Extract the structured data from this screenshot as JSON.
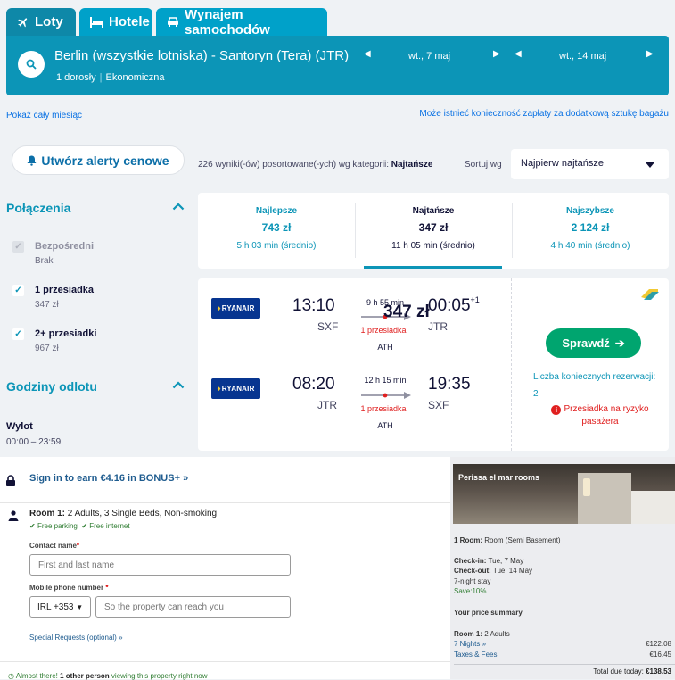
{
  "tabs": [
    {
      "label": "Loty",
      "icon": "plane-icon"
    },
    {
      "label": "Hotele",
      "icon": "bed-icon"
    },
    {
      "label": "Wynajem samochodów",
      "icon": "car-icon"
    }
  ],
  "search": {
    "route": "Berlin (wszystkie lotniska) - Santoryn (Tera) (JTR)",
    "passengers": "1 dorosły",
    "cabin": "Ekonomiczna",
    "depart_date": "wt., 7 maj",
    "return_date": "wt., 14 maj"
  },
  "links": {
    "month": "Pokaż cały miesiąc",
    "baggage": "Może istnieć konieczność zapłaty za dodatkową sztukę bagażu"
  },
  "alerts_button": "Utwórz alerty cenowe",
  "results": {
    "count_text": "226 wyniki(-ów) posortowane(-ych) wg kategorii: ",
    "sort_category": "Najtańsze",
    "sort_label": "Sortuj wg",
    "sort_value": "Najpierw najtańsze"
  },
  "filters": {
    "connections_title": "Połączenia",
    "options": [
      {
        "label": "Bezpośredni",
        "sub": "Brak",
        "checked": false,
        "disabled": true
      },
      {
        "label": "1 przesiadka",
        "sub": "347 zł",
        "checked": true,
        "disabled": false
      },
      {
        "label": "2+ przesiadki",
        "sub": "967 zł",
        "checked": true,
        "disabled": false
      }
    ],
    "times_title": "Godziny odlotu",
    "departure_label": "Wylot",
    "departure_range": "00:00 – 23:59"
  },
  "summary": [
    {
      "title": "Najlepsze",
      "price": "743 zł",
      "duration": "5 h 03 min (średnio)"
    },
    {
      "title": "Najtańsze",
      "price": "347 zł",
      "duration": "11 h 05 min (średnio)"
    },
    {
      "title": "Najszybsze",
      "price": "2 124 zł",
      "duration": "4 h 40 min (średnio)"
    }
  ],
  "itinerary": {
    "airline": "RYANAIR",
    "legs": [
      {
        "dep_time": "13:10",
        "dep_ap": "SXF",
        "duration": "9 h 55 min",
        "stops": "1 przesiadka",
        "via": "ATH",
        "arr_time": "00:05",
        "arr_offset": "+1",
        "arr_ap": "JTR"
      },
      {
        "dep_time": "08:20",
        "dep_ap": "JTR",
        "duration": "12 h 15 min",
        "stops": "1 przesiadka",
        "via": "ATH",
        "arr_time": "19:35",
        "arr_offset": "",
        "arr_ap": "SXF"
      }
    ],
    "price": "347 zł",
    "button": "Sprawdź",
    "bookings_required": "Liczba koniecznych rezerwacji: 2",
    "risk": "Przesiadka na ryzyko pasażera"
  },
  "hotel": {
    "bonus": "Sign in to earn €4.16 in BONUS+",
    "room_label": "Room 1:",
    "room_desc": "2 Adults, 3 Single Beds, Non-smoking",
    "perk1": "Free parking",
    "perk2": "Free internet",
    "contact_label": "Contact name",
    "contact_placeholder": "First and last name",
    "phone_label": "Mobile phone number",
    "country_code": "IRL +353",
    "phone_placeholder": "So the property can reach you",
    "special_requests": "Special Requests (optional)",
    "viewing_pre": "Almost there! ",
    "viewing_bold": "1 other person",
    "viewing_post": " viewing this property right now"
  },
  "summary_panel": {
    "hotel_name": "Perissa el mar rooms",
    "room_line_label": "1 Room:",
    "room_line": "Room (Semi Basement)",
    "checkin_label": "Check-in:",
    "checkin": "Tue, 7 May",
    "checkout_label": "Check-out:",
    "checkout": "Tue, 14 May",
    "stay": "7-night stay",
    "save": "Save:10%",
    "price_title": "Your price summary",
    "room_adults_label": "Room 1:",
    "room_adults": "2 Adults",
    "nights": "7 Nights",
    "nights_amount": "€122.08",
    "taxes": "Taxes & Fees",
    "taxes_amount": "€16.45",
    "total_label": "Total due today: ",
    "total_amount": "€138.53"
  }
}
